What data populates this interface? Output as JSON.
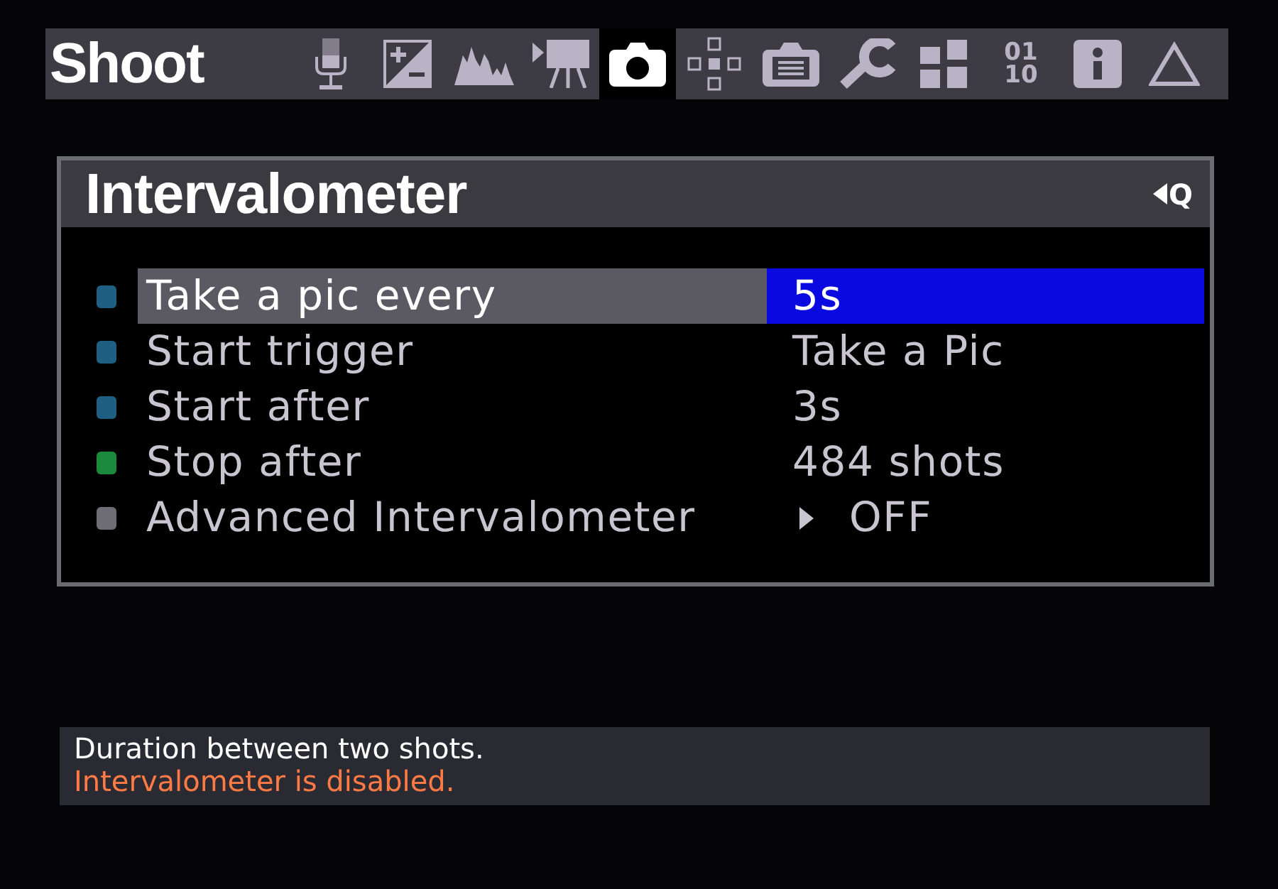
{
  "menu_title": "Shoot",
  "tabs": [
    {
      "kind": "microphone",
      "selected": false
    },
    {
      "kind": "exposure",
      "selected": false
    },
    {
      "kind": "histogram",
      "selected": false
    },
    {
      "kind": "movie",
      "selected": false
    },
    {
      "kind": "camera",
      "selected": true
    },
    {
      "kind": "focus",
      "selected": false
    },
    {
      "kind": "display",
      "selected": false
    },
    {
      "kind": "wrench",
      "selected": false
    },
    {
      "kind": "modules",
      "selected": false
    },
    {
      "kind": "debug",
      "label_lines": [
        "01",
        "10"
      ],
      "selected": false
    },
    {
      "kind": "info",
      "selected": false
    },
    {
      "kind": "triangle",
      "selected": false
    }
  ],
  "panel": {
    "title": "Intervalometer",
    "shortcut": "Q",
    "rows": [
      {
        "label": "Take a pic every",
        "value": "5s",
        "kind": "value",
        "color": "#1e5f82",
        "selected": true
      },
      {
        "label": "Start trigger",
        "value": "Take a Pic",
        "kind": "value",
        "color": "#1e5f82",
        "selected": false
      },
      {
        "label": "Start after",
        "value": "3s",
        "kind": "value",
        "color": "#1e5f82",
        "selected": false
      },
      {
        "label": "Stop after",
        "value": "484 shots",
        "kind": "value",
        "color": "#1c8a3c",
        "selected": false
      },
      {
        "label": "Advanced Intervalometer",
        "value": "OFF",
        "kind": "submenu",
        "color": "#6e6d76",
        "selected": false
      }
    ]
  },
  "help": [
    {
      "text": "Duration between two shots.",
      "kind": "info"
    },
    {
      "text": "Intervalometer is disabled.",
      "kind": "warning"
    }
  ]
}
